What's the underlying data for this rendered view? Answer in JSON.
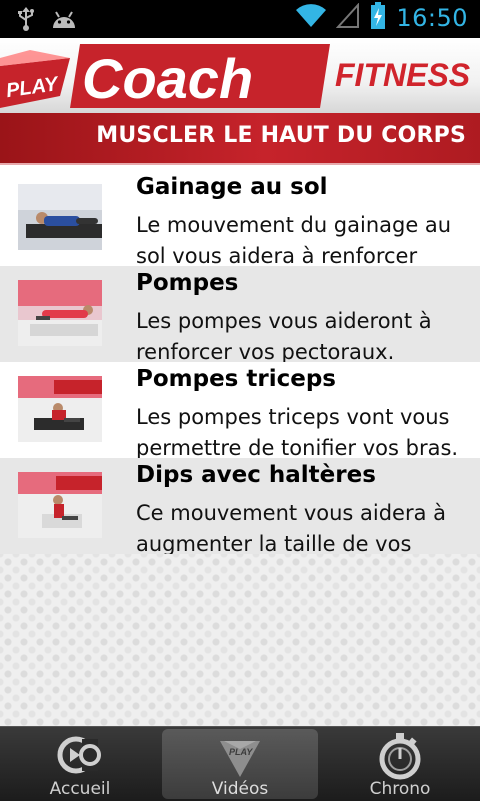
{
  "status_bar": {
    "time": "16:50",
    "icons": [
      "usb-icon",
      "android-icon",
      "wifi-icon",
      "signal-icon",
      "battery-charging-icon"
    ]
  },
  "header": {
    "logo": {
      "play": "PLAY",
      "coach": "Coach",
      "fitness": "FITNESS"
    }
  },
  "section_title": "MUSCLER LE HAUT DU CORPS",
  "exercises": [
    {
      "title": "Gainage au sol",
      "description": "Le mouvement du gainage au sol vous aidera à renforcer"
    },
    {
      "title": "Pompes",
      "description": "Les pompes vous aideront à renforcer vos pectoraux."
    },
    {
      "title": "Pompes triceps",
      "description": "Les pompes triceps vont vous permettre de tonifier vos bras."
    },
    {
      "title": "Dips avec haltères",
      "description": "Ce mouvement vous aidera à augmenter la taille de vos"
    }
  ],
  "tabs": [
    {
      "label": "Accueil",
      "icon": "coach-logo-icon"
    },
    {
      "label": "Vidéos",
      "icon": "play-icon",
      "active": true
    },
    {
      "label": "Chrono",
      "icon": "stopwatch-icon"
    }
  ],
  "colors": {
    "brand_red": "#c6232b",
    "status_blue": "#33b5e5"
  }
}
